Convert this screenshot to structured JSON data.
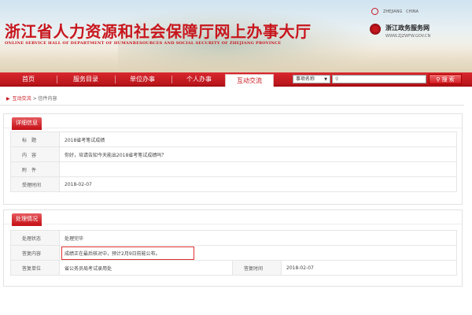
{
  "header": {
    "title": "浙江省人力资源和社会保障厅网上办事大厅",
    "subtitle": "ONLINE SERVICE HALL OF DEPARTMENT OF HUMANRESOURCES AND SOCIAL SECURITY OF ZHEJIANG PROVINCE",
    "zj_label": "ZHEJIANG",
    "china_label": "CHINA",
    "gov_title": "浙江政务服务网",
    "gov_url": "WWW.ZJZWFW.GOV.CN"
  },
  "nav": {
    "items": [
      {
        "label": "首页"
      },
      {
        "label": "服务目录"
      },
      {
        "label": "单位办事"
      },
      {
        "label": "个人办事"
      },
      {
        "label": "互动交流"
      }
    ],
    "active": "互动交流"
  },
  "search": {
    "select_value": "事项名称",
    "input_value": "",
    "button_label": "搜 索"
  },
  "breadcrumb": {
    "link": "互动交流",
    "separator": ">",
    "current": "信件内容"
  },
  "detail": {
    "tab_label": "详细信息",
    "rows": [
      {
        "label": "标　题",
        "value": "2018省考笔试成绩"
      },
      {
        "label": "内　容",
        "value": "你好，培请告知今天能出2018省考笔试成绩吗？"
      },
      {
        "label": "附　件",
        "value": ""
      },
      {
        "label": "受理时间",
        "value": "2018-02-07"
      }
    ]
  },
  "handling": {
    "tab_label": "处理情况",
    "status_label": "处理状态",
    "status_value": "处理完毕",
    "reply_label": "答复内容",
    "reply_value": "成绩正在最后核对中，预计2月9日前能公布。",
    "unit_label": "答复单位",
    "unit_value": "省公务员局考试录用处",
    "time_label": "答复时间",
    "time_value": "2018-02-07"
  },
  "colors": {
    "brand_red": "#c8161d",
    "highlight_box": "#e03030"
  }
}
